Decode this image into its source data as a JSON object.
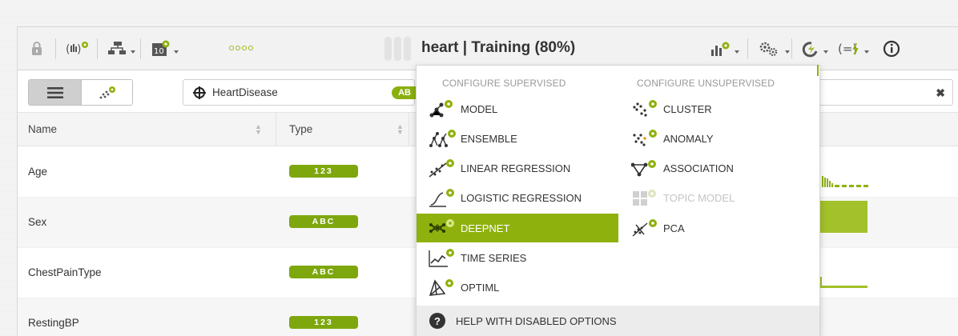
{
  "toolbar": {
    "title": "heart | Training (80%)"
  },
  "filters": {
    "objective_field": "HeartDisease",
    "objective_badge": "AB",
    "clear_label": "✖"
  },
  "table": {
    "headers": [
      "Name",
      "Type"
    ],
    "rows": [
      {
        "name": "Age",
        "type": "123"
      },
      {
        "name": "Sex",
        "type": "ABC"
      },
      {
        "name": "ChestPainType",
        "type": "ABC"
      },
      {
        "name": "RestingBP",
        "type": "123"
      }
    ]
  },
  "menu": {
    "supervised_heading": "CONFIGURE SUPERVISED",
    "unsupervised_heading": "CONFIGURE UNSUPERVISED",
    "supervised": [
      {
        "label": "MODEL",
        "icon": "model-icon"
      },
      {
        "label": "ENSEMBLE",
        "icon": "ensemble-icon"
      },
      {
        "label": "LINEAR REGRESSION",
        "icon": "linear-regression-icon"
      },
      {
        "label": "LOGISTIC REGRESSION",
        "icon": "logistic-regression-icon"
      },
      {
        "label": "DEEPNET",
        "icon": "deepnet-icon",
        "selected": true
      },
      {
        "label": "TIME SERIES",
        "icon": "time-series-icon"
      },
      {
        "label": "OPTIML",
        "icon": "optiml-icon"
      }
    ],
    "unsupervised": [
      {
        "label": "CLUSTER",
        "icon": "cluster-icon"
      },
      {
        "label": "ANOMALY",
        "icon": "anomaly-icon"
      },
      {
        "label": "ASSOCIATION",
        "icon": "association-icon"
      },
      {
        "label": "TOPIC MODEL",
        "icon": "topic-model-icon",
        "disabled": true
      },
      {
        "label": "PCA",
        "icon": "pca-icon"
      }
    ],
    "help_label": "HELP WITH DISABLED OPTIONS"
  },
  "colors": {
    "accent": "#8fb10e",
    "pill": "#7ea70e"
  }
}
